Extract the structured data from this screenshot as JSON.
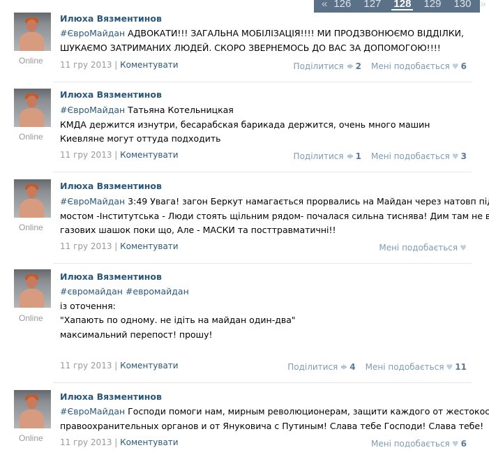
{
  "pager": {
    "prev": "«",
    "next": "»",
    "pages": [
      "126",
      "127",
      "128",
      "129",
      "130"
    ],
    "current": "128"
  },
  "posts": [
    {
      "author": "Илюха Вязментинов",
      "online": "Online",
      "tag": "#ЄвроМайдан",
      "first_line_rest": " АДВОКАТИ!!! ЗАГАЛЬНА МОБІЛІЗАЦІЯ!!!! МИ ПРОДЗВОНЮЄМО ВІДДІЛКИ,",
      "lines": [
        "ШУКАЄМО ЗАТРИМАНИХ ЛЮДЕЙ. СКОРО ЗВЕРНЕМОСЬ ДО ВАС ЗА ДОПОМОГОЮ!!!!"
      ],
      "date": "11 гру 2013",
      "comment_label": "Коментувати",
      "share_label": "Поділитися",
      "share_count": "2",
      "like_label": "Мені подобається",
      "like_count": "6"
    },
    {
      "author": "Илюха Вязментинов",
      "online": "Online",
      "tag": "#ЄвроМайдан",
      "first_line_rest": " Татьяна Котельницкая",
      "lines": [
        "КМДА держится изнутри, бесарабская барикада держится, очень много машин",
        "Киевляне могут оттуда подходить"
      ],
      "date": "11 гру 2013",
      "comment_label": "Коментувати",
      "share_label": "Поділитися",
      "share_count": "1",
      "like_label": "Мені подобається",
      "like_count": "3"
    },
    {
      "author": "Илюха Вязментинов",
      "online": "Online",
      "tag": "#ЄвроМайдан",
      "first_line_rest": " 3:49 Увага! загон Беркут намагається прорвались на Майдан через натовп під",
      "lines": [
        "мостом -Інститутська - Люди стоять щільним рядом- почалася сильна тиснява! Дим там не від",
        "газових шашок поки що, Але - МАСКИ та посттравматичні!!"
      ],
      "date": "11 гру 2013",
      "comment_label": "Коментувати",
      "share_label": "",
      "share_count": "",
      "like_label": "Мені подобається",
      "like_count": ""
    },
    {
      "author": "Илюха Вязментинов",
      "online": "Online",
      "tag": "#євромайдан #евромайдан",
      "first_line_rest": "",
      "lines": [
        "",
        "із оточення:",
        "\"Хапають по одному. не ідіть на майдан один-два\"",
        "максимальний перепост! прошу!"
      ],
      "date": "11 гру 2013",
      "comment_label": "Коментувати",
      "share_label": "Поділитися",
      "share_count": "4",
      "like_label": "Мені подобається",
      "like_count": "11"
    },
    {
      "author": "Илюха Вязментинов",
      "online": "Online",
      "tag": "#ЄвроМайдан",
      "first_line_rest": " Господи помоги нам, мирным революционерам, защити каждого от жестокости",
      "lines": [
        "правоохранительных органов и от Януковича с Путиным! Слава тебе Господи! Слава тебе!"
      ],
      "date": "11 гру 2013",
      "comment_label": "Коментувати",
      "share_label": "",
      "share_count": "",
      "like_label": "Мені подобається",
      "like_count": "6"
    }
  ],
  "separator": " | ",
  "icons": {
    "share": "megaphone-icon",
    "like": "heart-icon"
  },
  "colors": {
    "link": "#2b587a",
    "muted": "#999999",
    "pager_bg": "#5b7188"
  }
}
